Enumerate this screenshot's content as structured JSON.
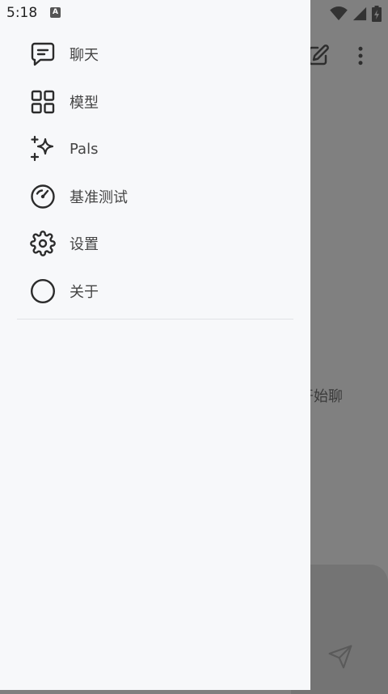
{
  "status_bar": {
    "time": "5:18",
    "indicator": "A"
  },
  "drawer": {
    "items": [
      {
        "label": "聊天",
        "icon": "chat-icon"
      },
      {
        "label": "模型",
        "icon": "grid-icon"
      },
      {
        "label": "Pals",
        "icon": "sparkles-icon"
      },
      {
        "label": "基准测试",
        "icon": "speedometer-icon"
      },
      {
        "label": "设置",
        "icon": "gear-icon"
      },
      {
        "label": "关于",
        "icon": "circle-icon"
      }
    ]
  },
  "background": {
    "partial_text": "开始聊"
  },
  "colors": {
    "drawer_bg": "#f7f8fa",
    "scrim": "#808080",
    "icon": "#2b2b2b",
    "label": "#444444"
  }
}
